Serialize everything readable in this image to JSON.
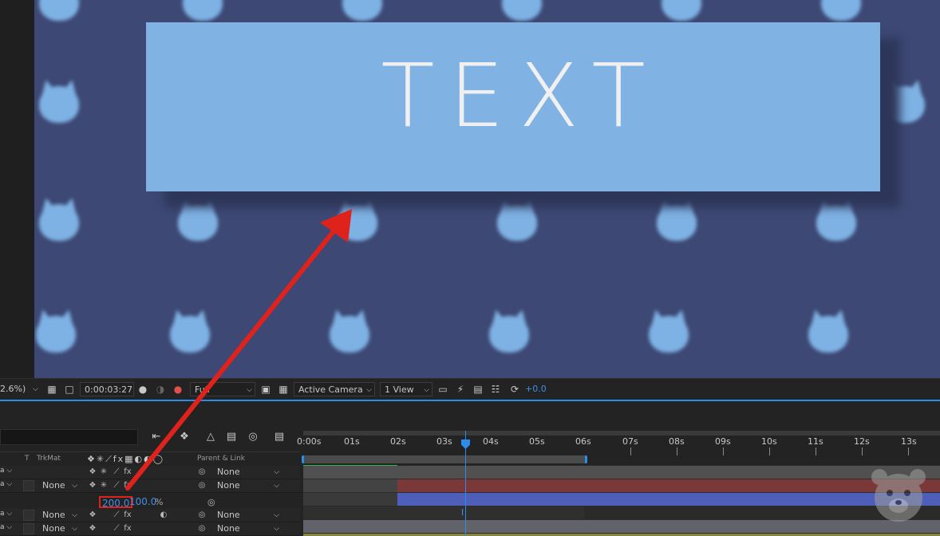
{
  "composition": {
    "text_layer": "TEXT"
  },
  "viewer_toolbar": {
    "zoom": "2.6%)",
    "timecode": "0:00:03:27",
    "resolution": "Full",
    "camera": "Active Camera",
    "views": "1 View",
    "exposure": "+0.0",
    "icons": [
      "region-of-interest-icon",
      "transparency-grid-icon",
      "snapshot-icon",
      "show-snapshot-icon",
      "color-channel-icon",
      "fast-preview-icon",
      "timeline-icon",
      "flowchart-icon",
      "reset-exposure-icon"
    ]
  },
  "timeline": {
    "columns": {
      "t": "T",
      "trkmat": "TrkMat",
      "parent_link": "Parent & Link"
    },
    "ruler_labels": [
      "0:00s",
      "01s",
      "02s",
      "03s",
      "04s",
      "05s",
      "06s",
      "07s",
      "08s",
      "09s",
      "10s",
      "11s",
      "12s",
      "13s"
    ],
    "layers": [
      {
        "trkmat": "",
        "parent": "None",
        "track_color": "#6a6a6a"
      },
      {
        "trkmat": "None",
        "parent": "None",
        "track_color": "#8a3a3a"
      },
      {
        "trkmat": "None",
        "parent": "None",
        "track_color": "#6a6a73"
      },
      {
        "trkmat": "None",
        "parent": "None",
        "track_color": "#8a8a3a"
      }
    ],
    "scale_property": {
      "x": "200.0",
      "y": "100.0",
      "unit": "%"
    },
    "colors": {
      "accent": "#2d8ceb",
      "annotation": "#e0221c"
    }
  }
}
